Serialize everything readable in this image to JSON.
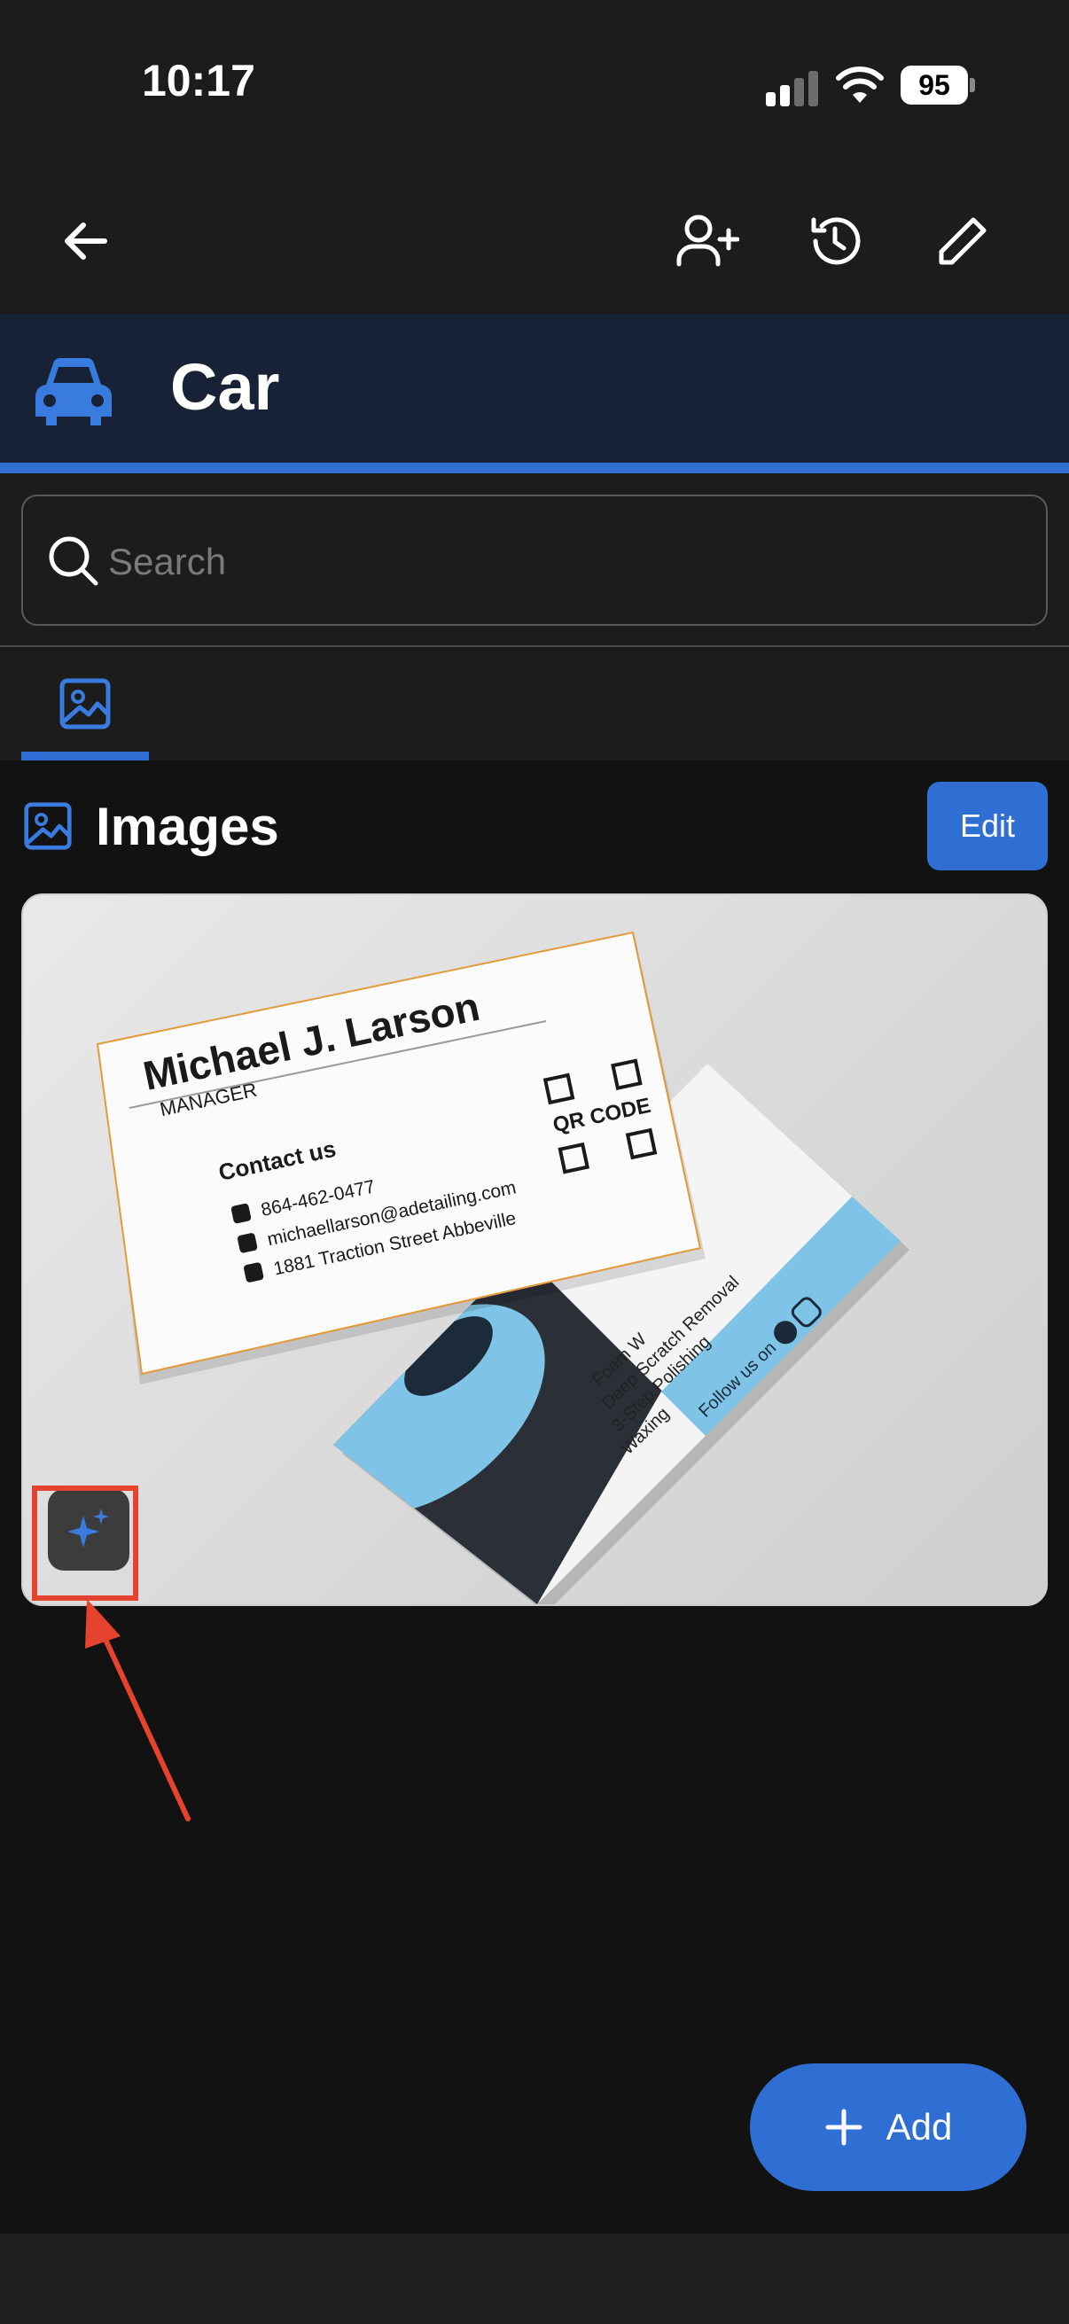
{
  "status_bar": {
    "time": "10:17",
    "battery": "95"
  },
  "toolbar": {
    "back_icon": "arrow-left-icon",
    "actions": [
      "add-person-icon",
      "history-icon",
      "pencil-icon"
    ]
  },
  "header": {
    "title": "Car",
    "icon": "car-icon"
  },
  "search": {
    "placeholder": "Search",
    "value": ""
  },
  "tabs": [
    {
      "icon": "image-icon",
      "active": true
    }
  ],
  "section": {
    "title": "Images",
    "edit_label": "Edit"
  },
  "business_card_front": {
    "name": "Michael J. Larson",
    "role": "MANAGER",
    "contact_heading": "Contact us",
    "phone": "864-462-0477",
    "email": "michaellarson@adetailing.com",
    "address": "1881 Traction Street Abbeville",
    "qr_label": "QR CODE"
  },
  "business_card_back": {
    "services": [
      "Foam W",
      "Deep Scratch Removal",
      "3-Step Polishing",
      "Waxing"
    ],
    "follow": "Follow us on"
  },
  "fab": {
    "label": "Add",
    "icon": "plus-icon"
  },
  "colors": {
    "accent": "#2f6fd4",
    "header_bg": "#172236",
    "annotation": "#e6432f",
    "card_blue": "#7fc4e6"
  }
}
